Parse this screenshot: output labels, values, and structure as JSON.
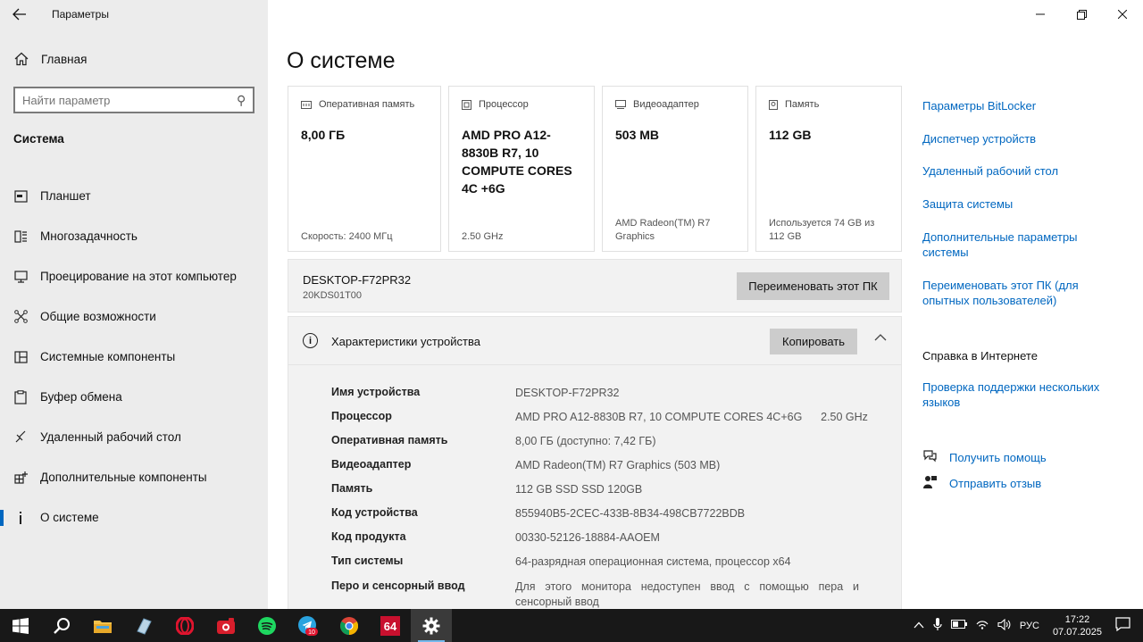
{
  "window": {
    "title": "Параметры"
  },
  "sidebar": {
    "home": "Главная",
    "search_placeholder": "Найти параметр",
    "section": "Система",
    "items": [
      {
        "label": "Планшет",
        "icon": "tablet-icon"
      },
      {
        "label": "Многозадачность",
        "icon": "multitasking-icon"
      },
      {
        "label": "Проецирование на этот компьютер",
        "icon": "projecting-icon"
      },
      {
        "label": "Общие возможности",
        "icon": "shared-experiences-icon"
      },
      {
        "label": "Системные компоненты",
        "icon": "system-components-icon"
      },
      {
        "label": "Буфер обмена",
        "icon": "clipboard-icon"
      },
      {
        "label": "Удаленный рабочий стол",
        "icon": "remote-desktop-icon"
      },
      {
        "label": "Дополнительные компоненты",
        "icon": "optional-features-icon"
      },
      {
        "label": "О системе",
        "icon": "info-icon",
        "active": true
      }
    ]
  },
  "main": {
    "title": "О системе",
    "cards": [
      {
        "label": "Оперативная память",
        "value": "8,00 ГБ",
        "foot": "Скорость: 2400 МГц",
        "icon": "ram-icon"
      },
      {
        "label": "Процессор",
        "value": "AMD PRO A12-8830B R7, 10 COMPUTE CORES 4C +6G",
        "foot": "2.50 GHz",
        "icon": "cpu-icon"
      },
      {
        "label": "Видеоадаптер",
        "value": "503 MB",
        "foot": "AMD Radeon(TM) R7 Graphics",
        "icon": "gpu-icon"
      },
      {
        "label": "Память",
        "value": "112 GB",
        "foot": "Используется 74 GB из 112 GB",
        "icon": "storage-icon"
      }
    ],
    "pc": {
      "name": "DESKTOP-F72PR32",
      "model": "20KDS01T00",
      "rename_button": "Переименовать этот ПК"
    },
    "specs": {
      "title": "Характеристики устройства",
      "copy_button": "Копировать",
      "rows": [
        {
          "k": "Имя устройства",
          "v": "DESKTOP-F72PR32"
        },
        {
          "k": "Процессор",
          "v": "AMD PRO A12-8830B R7, 10 COMPUTE CORES 4C+6G      2.50 GHz"
        },
        {
          "k": "Оперативная память",
          "v": "8,00 ГБ (доступно: 7,42 ГБ)"
        },
        {
          "k": "Видеоадаптер",
          "v": "AMD Radeon(TM) R7 Graphics (503 MB)"
        },
        {
          "k": "Память",
          "v": "112 GB SSD SSD 120GB"
        },
        {
          "k": "Код устройства",
          "v": "855940B5-2CEC-433B-8B34-498CB7722BDB"
        },
        {
          "k": "Код продукта",
          "v": "00330-52126-18884-AAOEM"
        },
        {
          "k": "Тип системы",
          "v": "64-разрядная операционная система, процессор x64"
        },
        {
          "k": "Перо и сенсорный ввод",
          "v": "Для этого монитора недоступен ввод с помощью пера и сенсорный ввод"
        }
      ]
    }
  },
  "related": {
    "links": [
      "Параметры BitLocker",
      "Диспетчер устройств",
      "Удаленный рабочий стол",
      "Защита системы",
      "Дополнительные параметры системы",
      "Переименовать этот ПК (для опытных пользователей)"
    ],
    "web_help_title": "Справка в Интернете",
    "web_links": [
      "Проверка поддержки нескольких языков"
    ],
    "help": "Получить помощь",
    "feedback": "Отправить отзыв"
  },
  "taskbar": {
    "apps": [
      "start-icon",
      "search-icon",
      "file-explorer-icon",
      "app-icon",
      "opera-icon",
      "screen-recorder-icon",
      "spotify-icon",
      "telegram-icon",
      "chrome-icon",
      "aida64-icon",
      "settings-icon"
    ],
    "telegram_badge": "10",
    "aida_label": "64",
    "lang": "РУС",
    "time": "17:22",
    "date": "07.07.2025"
  }
}
